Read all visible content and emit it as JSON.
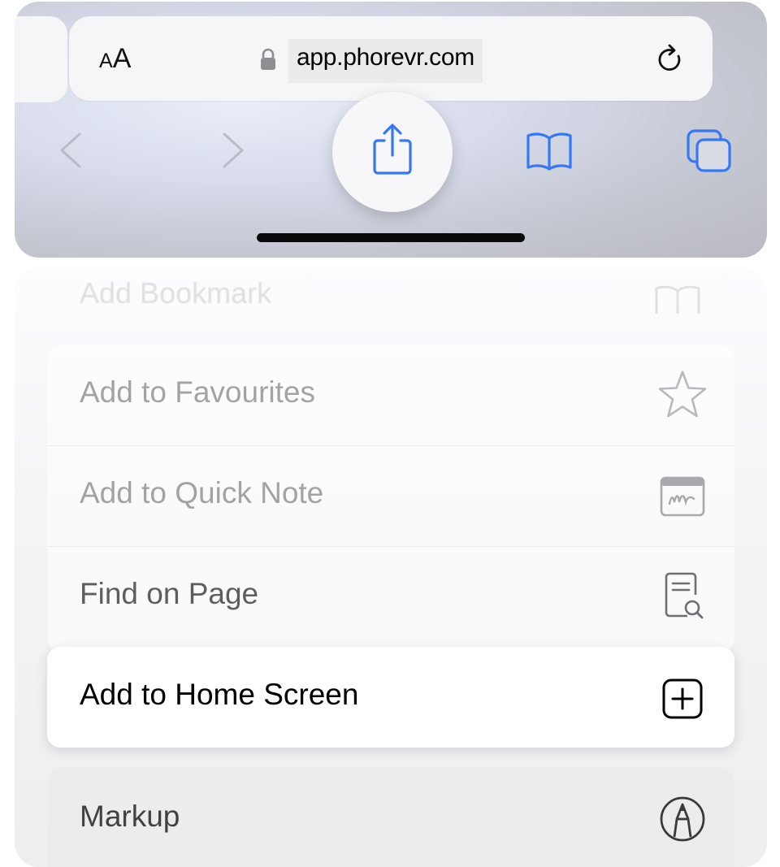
{
  "address_bar": {
    "text_size_small": "A",
    "text_size_big": "A",
    "url": "app.phorevr.com"
  },
  "toolbar": {
    "icons": [
      "back-icon",
      "forward-icon",
      "share-icon",
      "bookmarks-icon",
      "tabs-icon"
    ],
    "accent_color": "#3478f6"
  },
  "share_menu": {
    "partial_item": "Add Bookmark",
    "items": [
      {
        "label": "Add to Favourites",
        "icon": "star-icon"
      },
      {
        "label": "Add to Quick Note",
        "icon": "quick-note-icon"
      },
      {
        "label": "Find on Page",
        "icon": "find-on-page-icon"
      }
    ],
    "highlighted_item": {
      "label": "Add to Home Screen",
      "icon": "add-square-icon"
    },
    "next_item": {
      "label": "Markup",
      "icon": "markup-icon"
    }
  }
}
